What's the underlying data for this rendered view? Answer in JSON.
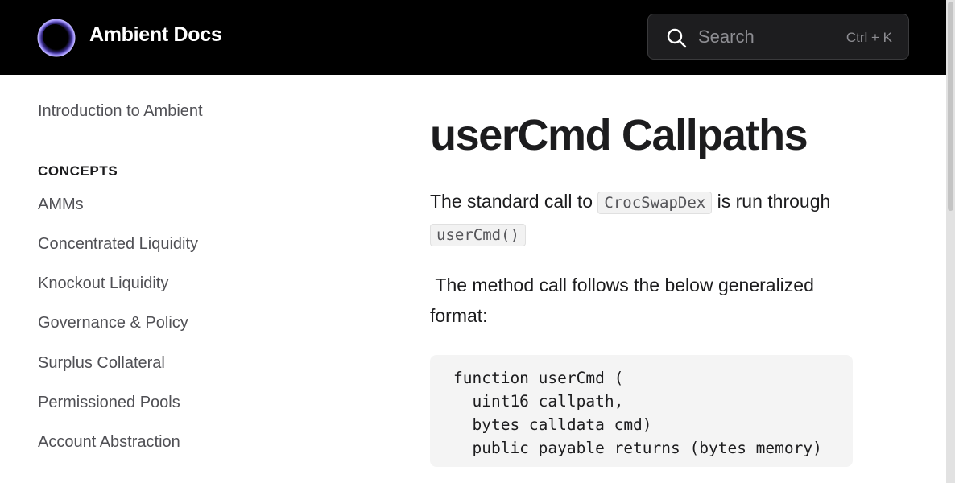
{
  "header": {
    "brand": "Ambient Docs",
    "search": {
      "placeholder": "Search",
      "shortcut": "Ctrl + K"
    }
  },
  "sidebar": {
    "intro": "Introduction to Ambient",
    "section_heading": "CONCEPTS",
    "items": [
      "AMMs",
      "Concentrated Liquidity",
      "Knockout Liquidity",
      "Governance & Policy",
      "Surplus Collateral",
      "Permissioned Pools",
      "Account Abstraction"
    ]
  },
  "main": {
    "title": "userCmd Callpaths",
    "para1": {
      "before": "The standard call to ",
      "code1": "CrocSwapDex",
      "middle": " is run through ",
      "code2": "userCmd()"
    },
    "para2": " The method call follows the below generalized format:",
    "code_lines": [
      "function userCmd (",
      "  uint16 callpath,",
      "  bytes calldata cmd)",
      "  public payable returns (bytes memory)"
    ]
  },
  "colors": {
    "header_bg": "#000000",
    "accent": "#7b6cf6"
  }
}
